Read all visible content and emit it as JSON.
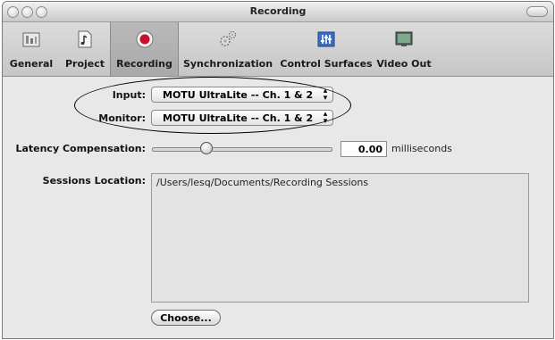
{
  "window": {
    "title": "Recording"
  },
  "toolbar": {
    "items": [
      {
        "label": "General",
        "icon": "general-icon"
      },
      {
        "label": "Project",
        "icon": "project-icon"
      },
      {
        "label": "Recording",
        "icon": "record-icon",
        "selected": true
      },
      {
        "label": "Synchronization",
        "icon": "gears-icon"
      },
      {
        "label": "Control Surfaces",
        "icon": "mixer-icon"
      },
      {
        "label": "Video Out",
        "icon": "display-icon"
      }
    ]
  },
  "form": {
    "input_label": "Input:",
    "input_value": "MOTU UltraLite -- Ch. 1 & 2",
    "monitor_label": "Monitor:",
    "monitor_value": "MOTU UltraLite -- Ch. 1 & 2",
    "latency_label": "Latency Compensation:",
    "latency_value": "0.00",
    "latency_fraction": 0.3,
    "latency_unit": "milliseconds",
    "sessions_label": "Sessions Location:",
    "sessions_path": "/Users/lesq/Documents/Recording Sessions",
    "choose_label": "Choose..."
  },
  "colors": {
    "window_bg": "#e8e8e8",
    "toolbar_bg": "#d0d0d0",
    "record_red": "#c8102e"
  }
}
